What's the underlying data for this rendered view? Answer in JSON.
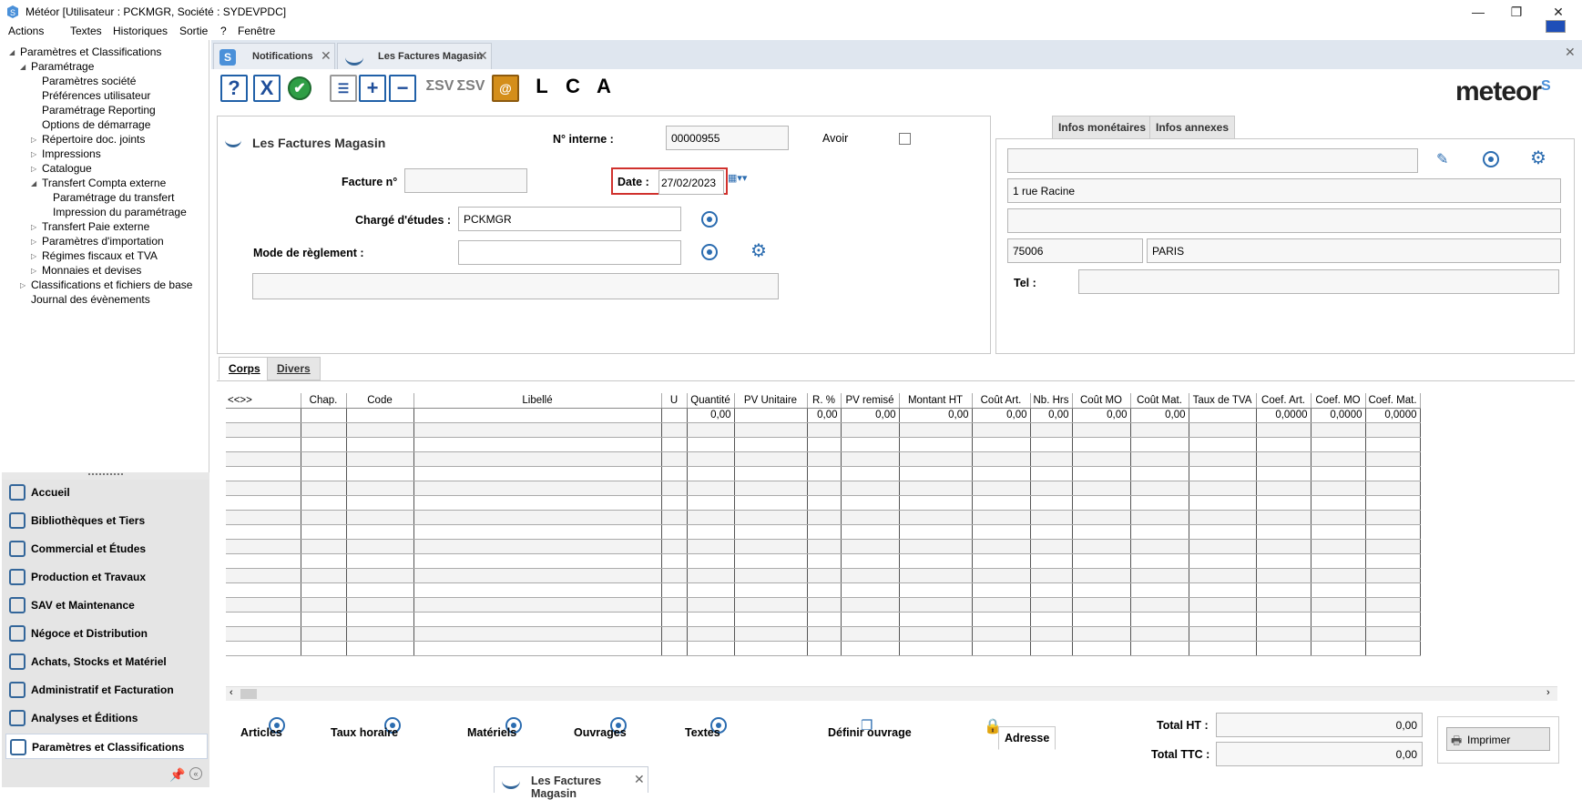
{
  "window": {
    "title": "Météor [Utilisateur : PCKMGR, Société : SYDEVPDC]",
    "minimize": "—",
    "restore": "❐",
    "close": "✕"
  },
  "menu": [
    "Actions",
    "Textes",
    "Historiques",
    "Sortie",
    "?",
    "Fenêtre"
  ],
  "tree": [
    {
      "label": "Paramètres et Classifications",
      "level": 0,
      "arrow": "◢"
    },
    {
      "label": "Paramétrage",
      "level": 1,
      "arrow": "◢"
    },
    {
      "label": "Paramètres société",
      "level": 2,
      "arrow": ""
    },
    {
      "label": "Préférences utilisateur",
      "level": 2,
      "arrow": ""
    },
    {
      "label": "Paramétrage Reporting",
      "level": 2,
      "arrow": ""
    },
    {
      "label": "Options de démarrage",
      "level": 2,
      "arrow": ""
    },
    {
      "label": "Répertoire doc. joints",
      "level": 2,
      "arrow": "▷"
    },
    {
      "label": "Impressions",
      "level": 2,
      "arrow": "▷"
    },
    {
      "label": "Catalogue",
      "level": 2,
      "arrow": "▷"
    },
    {
      "label": "Transfert Compta externe",
      "level": 2,
      "arrow": "◢"
    },
    {
      "label": "Paramétrage du transfert",
      "level": 3,
      "arrow": ""
    },
    {
      "label": "Impression du paramétrage",
      "level": 3,
      "arrow": ""
    },
    {
      "label": "Transfert Paie externe",
      "level": 2,
      "arrow": "▷"
    },
    {
      "label": "Paramètres d'importation",
      "level": 2,
      "arrow": "▷"
    },
    {
      "label": "Régimes fiscaux et TVA",
      "level": 2,
      "arrow": "▷"
    },
    {
      "label": "Monnaies et devises",
      "level": 2,
      "arrow": "▷"
    },
    {
      "label": "Classifications et fichiers de base",
      "level": 1,
      "arrow": "▷"
    },
    {
      "label": "Journal des évènements",
      "level": 1,
      "arrow": ""
    }
  ],
  "nav": [
    "Accueil",
    "Bibliothèques et Tiers",
    "Commercial et Études",
    "Production et Travaux",
    "SAV et Maintenance",
    "Négoce et Distribution",
    "Achats, Stocks et Matériel",
    "Administratif et Facturation",
    "Analyses et Éditions",
    "Paramètres et Classifications"
  ],
  "tabs": [
    {
      "label": "Notifications"
    },
    {
      "label": "Les Factures Magasin"
    },
    {
      "label": "Les Factures Magasin"
    }
  ],
  "toolbar": {
    "help": "?",
    "cancel": "X",
    "ok": "✔",
    "add": "+",
    "remove": "−",
    "sv1": "ΣSV",
    "sv2": "ΣSV",
    "book": "@",
    "L": "L",
    "C": "C",
    "A": "A"
  },
  "logo": {
    "text": "meteor",
    "mark": "S"
  },
  "form": {
    "title": "Les Factures Magasin",
    "n_interne_label": "N° interne :",
    "n_interne_value": "00000955",
    "avoir_label": "Avoir",
    "facture_label": "Facture n°",
    "facture_value": "",
    "date_label": "Date :",
    "date_value": "27/02/2023",
    "charge_label": "Chargé d'études :",
    "charge_value": "PCKMGR",
    "mode_label": "Mode de règlement :",
    "mode_value": "",
    "note_value": ""
  },
  "address_tabs": [
    "Adresse",
    "Infos monétaires",
    "Infos annexes"
  ],
  "address": {
    "line0": "",
    "line1": "1 rue Racine",
    "line2": "",
    "zip": "75006",
    "city": "PARIS",
    "tel_label": "Tel :",
    "tel_value": ""
  },
  "body_tabs": [
    "Corps",
    "Divers"
  ],
  "grid": {
    "nav": "<<>>",
    "columns": [
      "Chap.",
      "Code",
      "Libellé",
      "U",
      "Quantité",
      "PV Unitaire",
      "R. %",
      "PV remisé",
      "Montant HT",
      "Coût Art.",
      "Nb. Hrs",
      "Coût MO",
      "Coût Mat.",
      "Taux de TVA",
      "Coef. Art.",
      "Coef. MO",
      "Coef. Mat."
    ],
    "first_row": [
      "",
      "",
      "",
      "",
      "0,00",
      "",
      "0,00",
      "0,00",
      "0,00",
      "0,00",
      "0,00",
      "0,00",
      "0,00",
      "",
      "0,0000",
      "0,0000",
      "0,0000"
    ]
  },
  "actions": [
    "Articles",
    "Taux horaire",
    "Matériels",
    "Ouvrages",
    "Textes",
    "Définir ouvrage"
  ],
  "totals": {
    "ht_label": "Total HT :",
    "ht_value": "0,00",
    "ttc_label": "Total TTC :",
    "ttc_value": "0,00"
  },
  "print_label": "Imprimer",
  "colors": {
    "accent": "#2b6cb0",
    "highlight": "#d0312d"
  }
}
